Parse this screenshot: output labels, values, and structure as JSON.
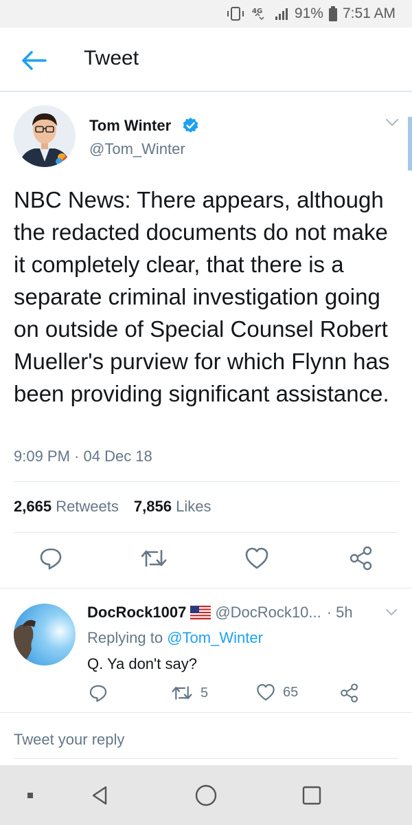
{
  "status_bar": {
    "network": "4G",
    "battery": "91%",
    "time": "7:51 AM"
  },
  "app_bar": {
    "title": "Tweet"
  },
  "tweet": {
    "author_name": "Tom Winter",
    "author_handle": "@Tom_Winter",
    "text": "NBC News: There appears, although the redacted documents do not make it completely clear, that there is a separate criminal investigation going on outside of Special Counsel Robert Mueller's purview for which Flynn has been providing significant assistance.",
    "timestamp": "9:09 PM · 04 Dec 18",
    "retweets_count": "2,665",
    "retweets_label": "Retweets",
    "likes_count": "7,856",
    "likes_label": "Likes"
  },
  "reply": {
    "name": "DocRock1007",
    "handle": "@DocRock10...",
    "time": "· 5h",
    "replying_prefix": "Replying to",
    "replying_to": "@Tom_Winter",
    "text": "Q. Ya don't say?",
    "retweet_count": "5",
    "like_count": "65"
  },
  "compose": {
    "placeholder": "Tweet your reply"
  },
  "colors": {
    "accent": "#1da1f2",
    "secondary_text": "#657786",
    "divider": "#e1e8ed"
  },
  "icons": {
    "back": "arrow-left-icon",
    "verified": "verified-badge-icon",
    "reply": "comment-bubble-icon",
    "retweet": "retweet-icon",
    "like": "heart-icon",
    "share": "share-icon"
  }
}
